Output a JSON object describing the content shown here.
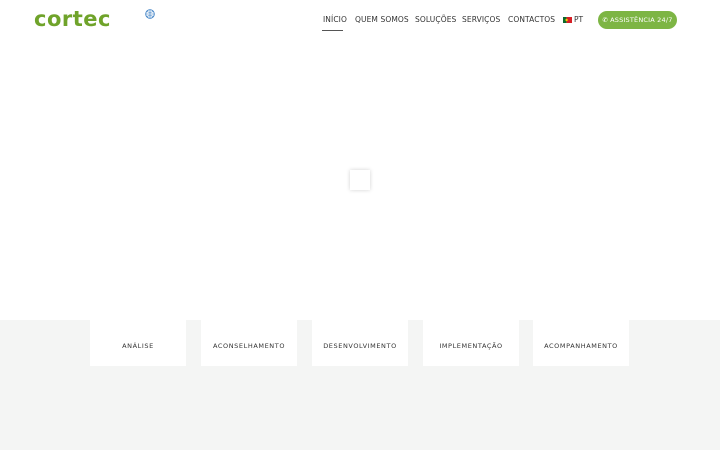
{
  "brand": {
    "logo_text": "cortec",
    "accent_color": "#7db544"
  },
  "nav": {
    "items": [
      {
        "label": "INÍCIO",
        "active": true
      },
      {
        "label": "QUEM SOMOS"
      },
      {
        "label": "SOLUÇÕES"
      },
      {
        "label": "SERVIÇOS"
      },
      {
        "label": "CONTACTOS"
      }
    ],
    "language": {
      "label": "PT",
      "icon": "portugal-flag-icon"
    }
  },
  "assist_button": {
    "label": "ASSISTÊNCIA 24/7",
    "icon": "phone-icon"
  },
  "services": {
    "cards": [
      {
        "label": "ANÁLISE"
      },
      {
        "label": "ACONSELHAMENTO"
      },
      {
        "label": "DESENVOLVIMENTO"
      },
      {
        "label": "IMPLEMENTAÇÃO"
      },
      {
        "label": "ACOMPANHAMENTO"
      }
    ]
  }
}
